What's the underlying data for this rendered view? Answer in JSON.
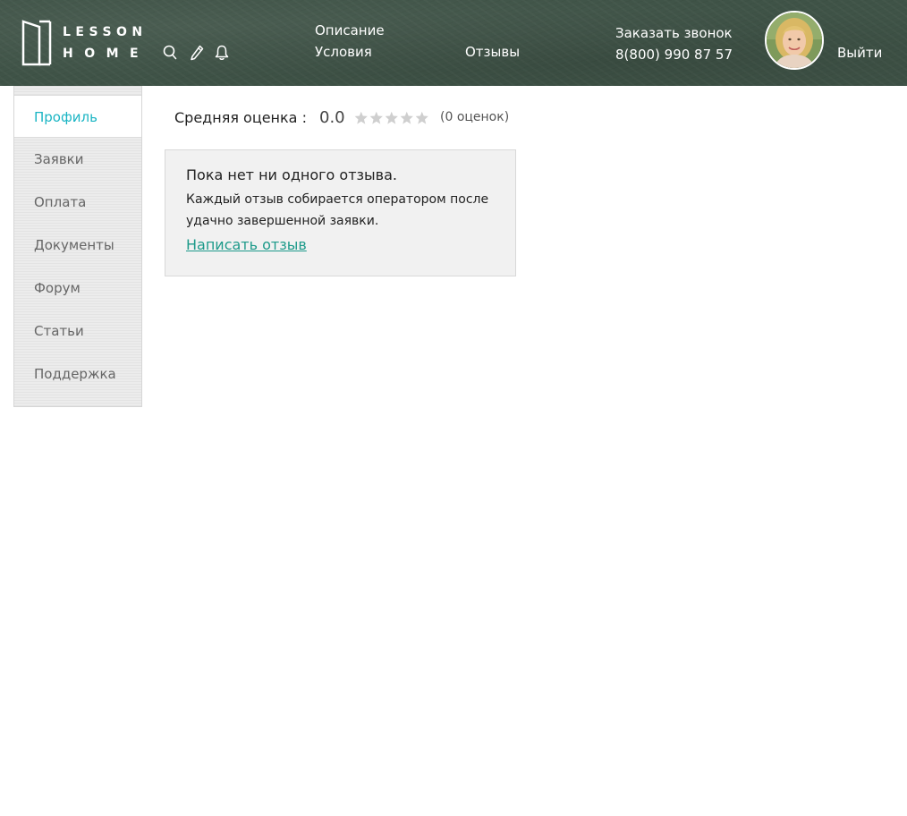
{
  "header": {
    "logo": {
      "line1": "LESSON",
      "line2": "HOME"
    },
    "icons": [
      "search-icon",
      "pencil-icon",
      "bell-icon"
    ],
    "nav": {
      "description": "Описание",
      "terms": "Условия",
      "reviews": "Отзывы"
    },
    "callback": {
      "title": "Заказать звонок",
      "phone": "8(800) 990 87 57"
    },
    "logout": "Выйти"
  },
  "sidebar": {
    "active_color": "#1bb5c4",
    "items": [
      {
        "label": "Профиль",
        "active": true
      },
      {
        "label": "Заявки",
        "active": false
      },
      {
        "label": "Оплата",
        "active": false
      },
      {
        "label": "Документы",
        "active": false
      },
      {
        "label": "Форум",
        "active": false
      },
      {
        "label": "Статьи",
        "active": false
      },
      {
        "label": "Поддержка",
        "active": false
      }
    ]
  },
  "main": {
    "rating": {
      "label": "Средняя оценка :",
      "value": "0.0",
      "stars_filled": 0,
      "stars_total": 5,
      "count": "(0 оценок)"
    },
    "empty": {
      "title": "Пока нет ни одного отзыва.",
      "text": "Каждый отзыв собирается оператором после удачно завершенной заявки.",
      "link": "Написать отзыв",
      "link_color": "#1d9a8a"
    }
  }
}
